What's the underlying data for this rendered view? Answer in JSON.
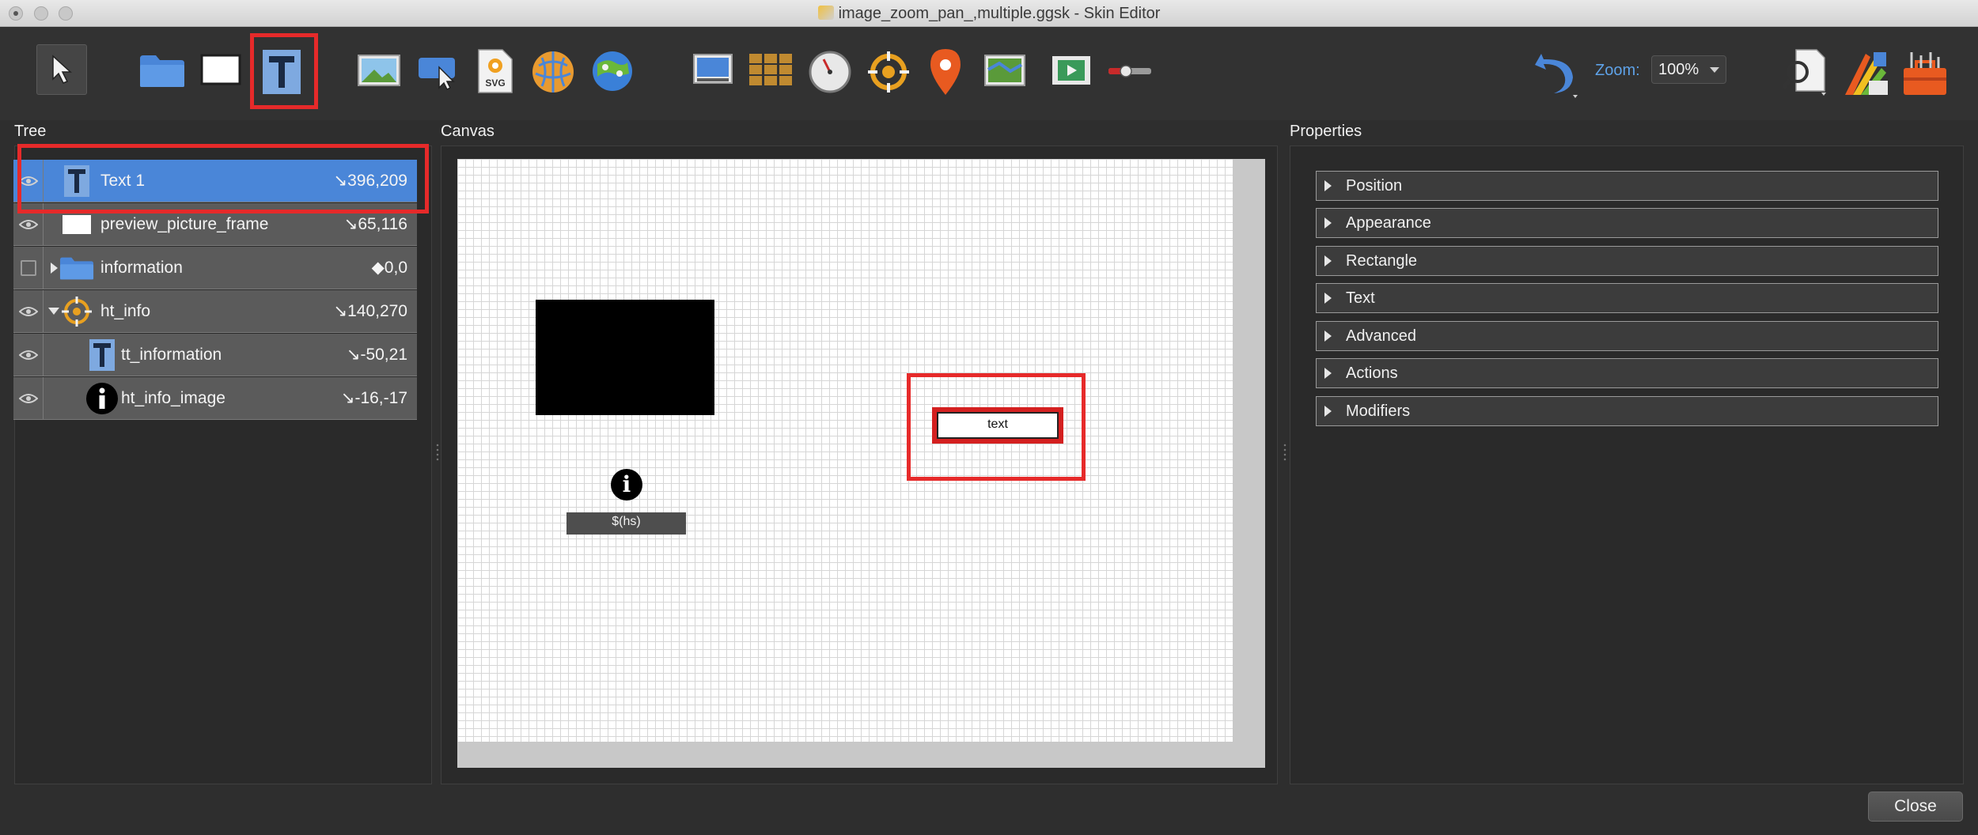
{
  "window": {
    "title": "image_zoom_pan_,multiple.ggsk - Skin Editor"
  },
  "toolbar": {
    "zoom_label": "Zoom:",
    "zoom_value": "100%",
    "svg_badge": "SVG",
    "tools": [
      "select-arrow-icon",
      "folder-icon",
      "rectangle-icon",
      "text-tool-icon",
      "image-icon",
      "button-cursor-icon",
      "svg-icon",
      "polygon-hotspot-icon",
      "map-icon",
      "screen-icon",
      "cloner-icon",
      "timer-icon",
      "hotspot-icon",
      "map-pin-icon",
      "map-image-icon",
      "video-icon",
      "slider-icon",
      "undo-icon",
      "search-icon",
      "palette-icon",
      "toolbox-icon"
    ],
    "selected_tool": "text-tool-icon"
  },
  "tree": {
    "label": "Tree",
    "rows": [
      {
        "name": "Text 1",
        "coord": "↘396,209",
        "icon": "text-element-icon",
        "visible": true,
        "selected": true
      },
      {
        "name": "preview_picture_frame",
        "coord": "↘65,116",
        "icon": "rectangle-element-icon",
        "visible": true,
        "selected": false
      },
      {
        "name": "information",
        "coord": "◆0,0",
        "icon": "folder-icon",
        "visible": false,
        "selected": false,
        "expandable": "collapsed"
      },
      {
        "name": "ht_info",
        "coord": "↘140,270",
        "icon": "hotspot-icon",
        "visible": true,
        "selected": false,
        "expandable": "expanded"
      },
      {
        "name": "tt_information",
        "coord": "↘-50,21",
        "icon": "text-element-icon",
        "visible": true,
        "selected": false
      },
      {
        "name": "ht_info_image",
        "coord": "↘-16,-17",
        "icon": "info-icon",
        "visible": true,
        "selected": false
      }
    ]
  },
  "canvas": {
    "label": "Canvas",
    "text_element_label": "text",
    "hotspot_text": "$(hs)",
    "info_glyph": "i"
  },
  "properties": {
    "label": "Properties",
    "sections": [
      "Position",
      "Appearance",
      "Rectangle",
      "Text",
      "Advanced",
      "Actions",
      "Modifiers"
    ]
  },
  "footer": {
    "close_label": "Close"
  },
  "colors": {
    "accent": "#4a86d8",
    "highlight": "#e62a2a",
    "background": "#2e2e2e"
  }
}
